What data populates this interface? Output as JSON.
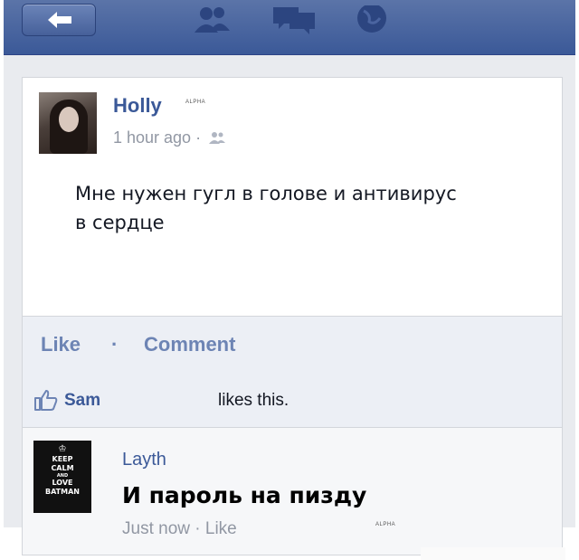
{
  "nav": {
    "icons": [
      "back-arrow-icon",
      "friend-requests-icon",
      "messages-icon",
      "notifications-globe-icon"
    ],
    "colors": {
      "bar": "#3b5998",
      "link": "#3b5998",
      "muted": "#9197a3",
      "action": "#6d84b4"
    }
  },
  "post": {
    "author": "Holly",
    "author_mark": "ALPHA",
    "timestamp": "1 hour ago",
    "separator": "·",
    "privacy_icon": "friends-icon",
    "text_line1": "Мне нужен гугл в голове и антивирус",
    "text_line2": "в сердце"
  },
  "actions": {
    "like": "Like",
    "separator": "·",
    "comment": "Comment"
  },
  "likes": {
    "icon": "thumbs-up-icon",
    "name": "Sam",
    "text": "likes this."
  },
  "comment": {
    "avatar_text": [
      "KEEP",
      "CALM",
      "AND",
      "LOVE",
      "BATMAN"
    ],
    "author": "Layth",
    "text": "И пароль на пизду",
    "time": "Just now",
    "separator": "·",
    "like": "Like",
    "mark": "ALPHA"
  }
}
